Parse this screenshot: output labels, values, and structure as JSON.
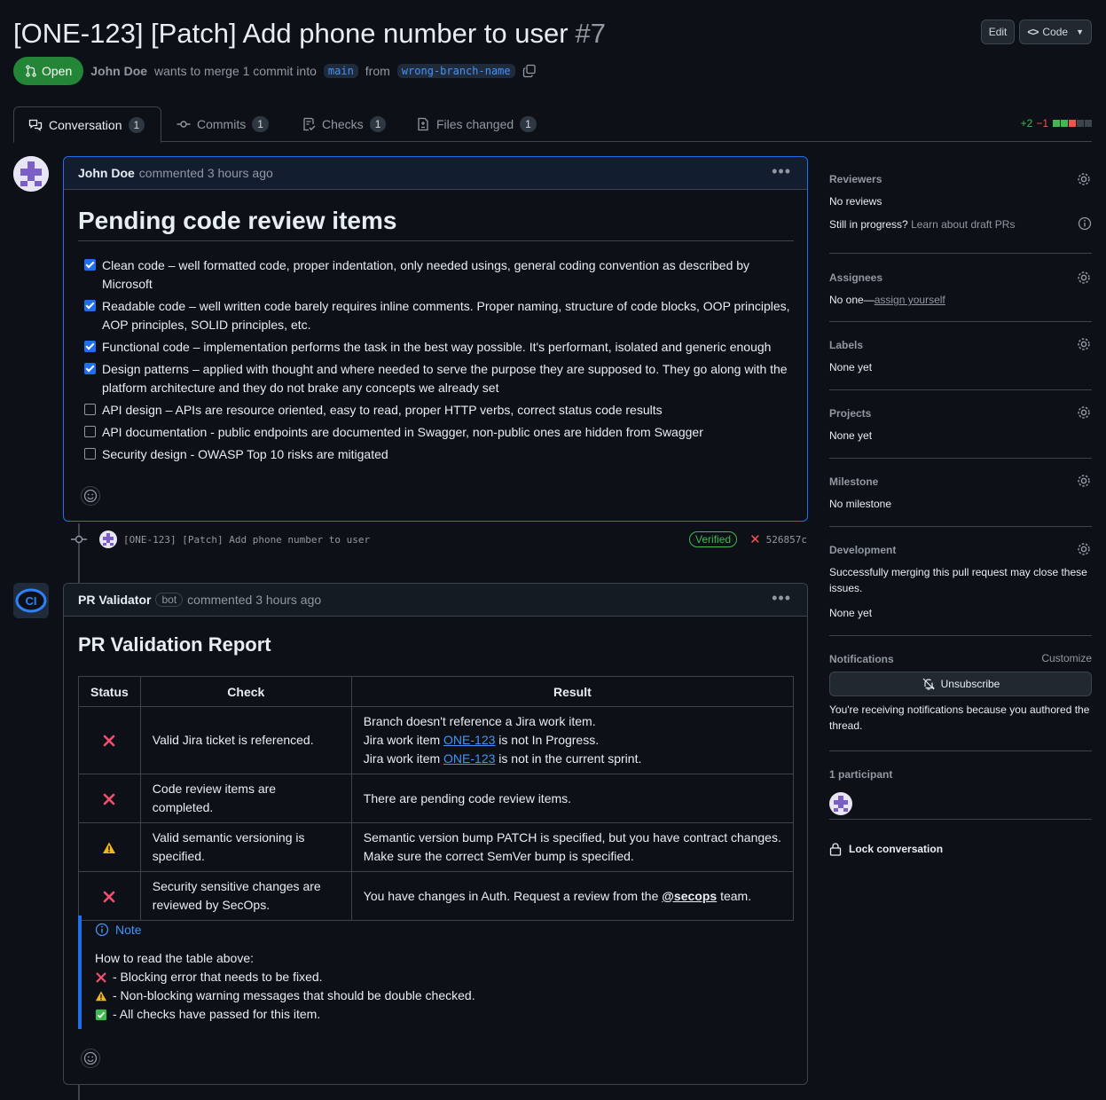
{
  "header": {
    "title": "[ONE-123] [Patch] Add phone number to user",
    "number": "#7",
    "edit_label": "Edit",
    "code_label": "Code"
  },
  "meta": {
    "state": "Open",
    "author": "John Doe",
    "merge_text": "wants to merge 1 commit into",
    "base_branch": "main",
    "from_text": "from",
    "head_branch": "wrong-branch-name"
  },
  "tabs": [
    {
      "label": "Conversation",
      "count": "1"
    },
    {
      "label": "Commits",
      "count": "1"
    },
    {
      "label": "Checks",
      "count": "1"
    },
    {
      "label": "Files changed",
      "count": "1"
    }
  ],
  "diffstat": {
    "additions": "+2",
    "deletions": "−1"
  },
  "comment1": {
    "author": "John Doe",
    "action": "commented 3 hours ago",
    "heading": "Pending code review items",
    "tasks": [
      {
        "text": "Clean code – well formatted code, proper indentation, only needed usings, general coding convention as described by Microsoft",
        "checked": true
      },
      {
        "text": "Readable code – well written code barely requires inline comments. Proper naming, structure of code blocks, OOP principles, AOP principles, SOLID principles, etc.",
        "checked": true
      },
      {
        "text": "Functional code – implementation performs the task in the best way possible. It's performant, isolated and generic enough",
        "checked": true
      },
      {
        "text": "Design patterns – applied with thought and where needed to serve the purpose they are supposed to. They go along with the platform architecture and they do not brake any concepts we already set",
        "checked": true
      },
      {
        "text": "API design – APIs are resource oriented, easy to read, proper HTTP verbs, correct status code results",
        "checked": false
      },
      {
        "text": "API documentation - public endpoints are documented in Swagger, non-public ones are hidden from Swagger",
        "checked": false
      },
      {
        "text": "Security design - OWASP Top 10 risks are mitigated",
        "checked": false
      }
    ]
  },
  "commit": {
    "message": "[ONE-123] [Patch] Add phone number to user",
    "verified": "Verified",
    "sha": "526857c"
  },
  "comment2": {
    "author": "PR Validator",
    "bot_badge": "bot",
    "action": "commented 3 hours ago",
    "avatar_text": "CI",
    "heading": "PR Validation Report",
    "table_headers": [
      "Status",
      "Check",
      "Result"
    ],
    "rows": [
      {
        "status": "error",
        "check": "Valid Jira ticket is referenced.",
        "result_lines": [
          {
            "pre": "Branch doesn't reference a Jira work item.",
            "link": "",
            "post": ""
          },
          {
            "pre": "Jira work item ",
            "link": "ONE-123",
            "post": " is not In Progress."
          },
          {
            "pre": "Jira work item ",
            "link": "ONE-123",
            "post": " is not in the current sprint."
          }
        ]
      },
      {
        "status": "error",
        "check": "Code review items are completed.",
        "result_lines": [
          {
            "pre": "There are pending code review items.",
            "link": "",
            "post": ""
          }
        ]
      },
      {
        "status": "warning",
        "check": "Valid semantic versioning is specified.",
        "result_lines": [
          {
            "pre": "Semantic version bump PATCH is specified, but you have contract changes.",
            "link": "",
            "post": ""
          },
          {
            "pre": "Make sure the correct SemVer bump is specified.",
            "link": "",
            "post": ""
          }
        ]
      },
      {
        "status": "error",
        "check": "Security sensitive changes are reviewed by SecOps.",
        "result_lines": [
          {
            "pre": "You have changes in Auth. Request a review from the ",
            "link": "@secops",
            "post": " team."
          }
        ]
      }
    ],
    "note": {
      "title": "Note",
      "intro": "How to read the table above:",
      "items": [
        {
          "icon": "error",
          "text": "- Blocking error that needs to be fixed."
        },
        {
          "icon": "warning",
          "text": "- Non-blocking warning messages that should be double checked."
        },
        {
          "icon": "pass",
          "text": "- All checks have passed for this item."
        }
      ]
    }
  },
  "sidebar": {
    "reviewers_title": "Reviewers",
    "reviewers_value": "No reviews",
    "draft_text": "Still in progress?",
    "draft_link": "Learn about draft PRs",
    "assignees_title": "Assignees",
    "assignees_value": "No one—",
    "assignees_link": "assign yourself",
    "labels_title": "Labels",
    "labels_value": "None yet",
    "projects_title": "Projects",
    "projects_value": "None yet",
    "milestone_title": "Milestone",
    "milestone_value": "No milestone",
    "development_title": "Development",
    "development_text": "Successfully merging this pull request may close these issues.",
    "development_value": "None yet",
    "notifications_title": "Notifications",
    "customize_label": "Customize",
    "unsubscribe_label": "Unsubscribe",
    "notifications_reason": "You're receiving notifications because you authored the thread.",
    "participants_title": "1 participant",
    "lock_label": "Lock conversation"
  },
  "colors": {
    "accent": "#1f6feb",
    "open": "#238636",
    "error": "#f85149",
    "warning": "#d29922",
    "pass": "#3fb950"
  }
}
